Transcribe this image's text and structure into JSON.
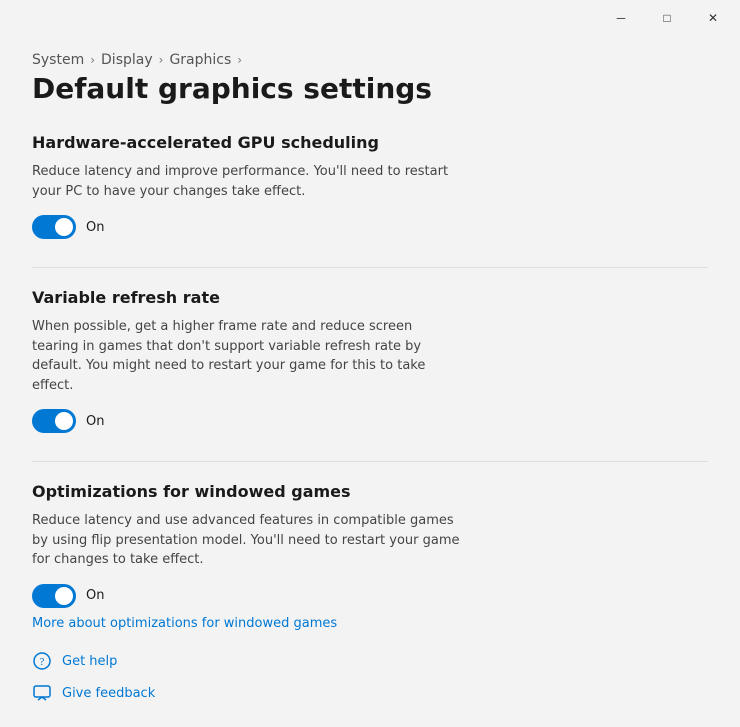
{
  "titleBar": {
    "minimizeLabel": "─",
    "maximizeLabel": "□",
    "closeLabel": "✕"
  },
  "breadcrumb": {
    "items": [
      {
        "label": "System"
      },
      {
        "label": "Display"
      },
      {
        "label": "Graphics"
      }
    ],
    "separator": "›",
    "currentPage": "Default graphics settings"
  },
  "sections": [
    {
      "id": "gpu-scheduling",
      "title": "Hardware-accelerated GPU scheduling",
      "description": "Reduce latency and improve performance. You'll need to restart your PC to have your changes take effect.",
      "toggleState": true,
      "toggleLabel": "On",
      "link": null
    },
    {
      "id": "variable-refresh-rate",
      "title": "Variable refresh rate",
      "description": "When possible, get a higher frame rate and reduce screen tearing in games that don't support variable refresh rate by default. You might need to restart your game for this to take effect.",
      "toggleState": true,
      "toggleLabel": "On",
      "link": null
    },
    {
      "id": "windowed-games",
      "title": "Optimizations for windowed games",
      "description": "Reduce latency and use advanced features in compatible games by using flip presentation model. You'll need to restart your game for changes to take effect.",
      "toggleState": true,
      "toggleLabel": "On",
      "link": "More about optimizations for windowed games"
    }
  ],
  "footer": {
    "getHelp": "Get help",
    "giveFeedback": "Give feedback"
  },
  "colors": {
    "accent": "#0078d4",
    "toggleOn": "#0078d4"
  }
}
